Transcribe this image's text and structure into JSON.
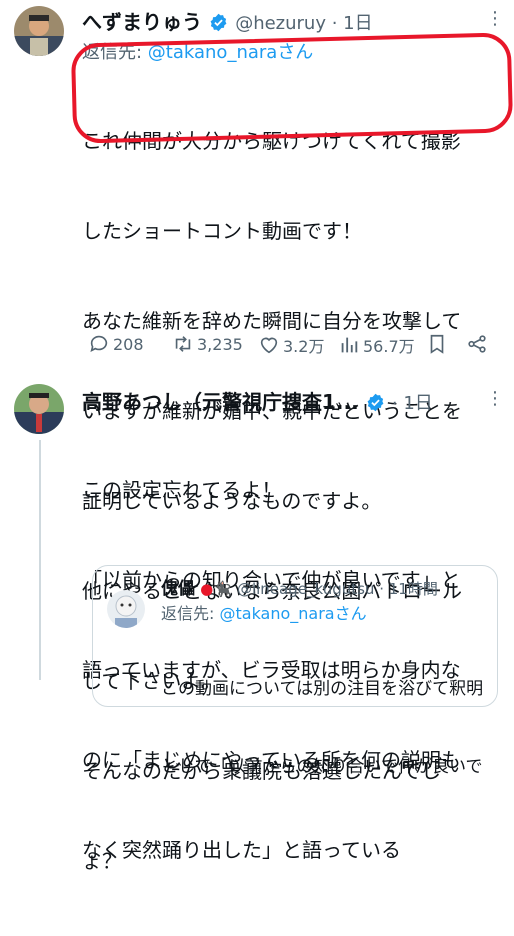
{
  "tweet1": {
    "name": "へずまりゅう",
    "handle_time": "@hezuruy · 1日",
    "more": "⋮",
    "reply_prefix": "返信先: ",
    "reply_to": "@takano_naraさん",
    "lines": [
      "これ仲間が大分から駆けつけてくれて撮影",
      "したショートコント動画です！",
      "あなた維新を辞めた瞬間に自分を攻撃して",
      "いますが維新が媚中、親中だということを",
      "証明しているようなものですよ。",
      "他にやることないなら奈良公園パトロール",
      "して下さいよ。",
      "そんなのだから衆議院も落選したんでし",
      "ょ？"
    ],
    "replies": "208",
    "retweets": "3,235",
    "likes": "3.2万",
    "views": "56.7万"
  },
  "tweet2": {
    "name": "高野あつし（元警視庁捜査1...",
    "time": "· 1日",
    "more": "⋮",
    "lines": [
      "この設定忘れてるよ！",
      "「以前からの知り合いで仲が良いです」と",
      "語っていますが、ビラ受取は明らか身内な",
      "のに「まじめにやっている所を何の説明も",
      "なく突然踊り出した」と語っている"
    ]
  },
  "quote": {
    "name": "傀儡",
    "emoji": "●🐈‍⬛",
    "handle_time": "@lineage_kugutsu · 11時間",
    "reply_prefix": "返信先: ",
    "reply_to": "@takano_naraさん",
    "lines": [
      "この動画については別の注目を浴びて釈明",
      "として「以前からの知り合いで仲が良いで"
    ]
  },
  "colors": {
    "accent": "#1d9bf0",
    "muted": "#536471",
    "highlight": "#e8172a"
  }
}
